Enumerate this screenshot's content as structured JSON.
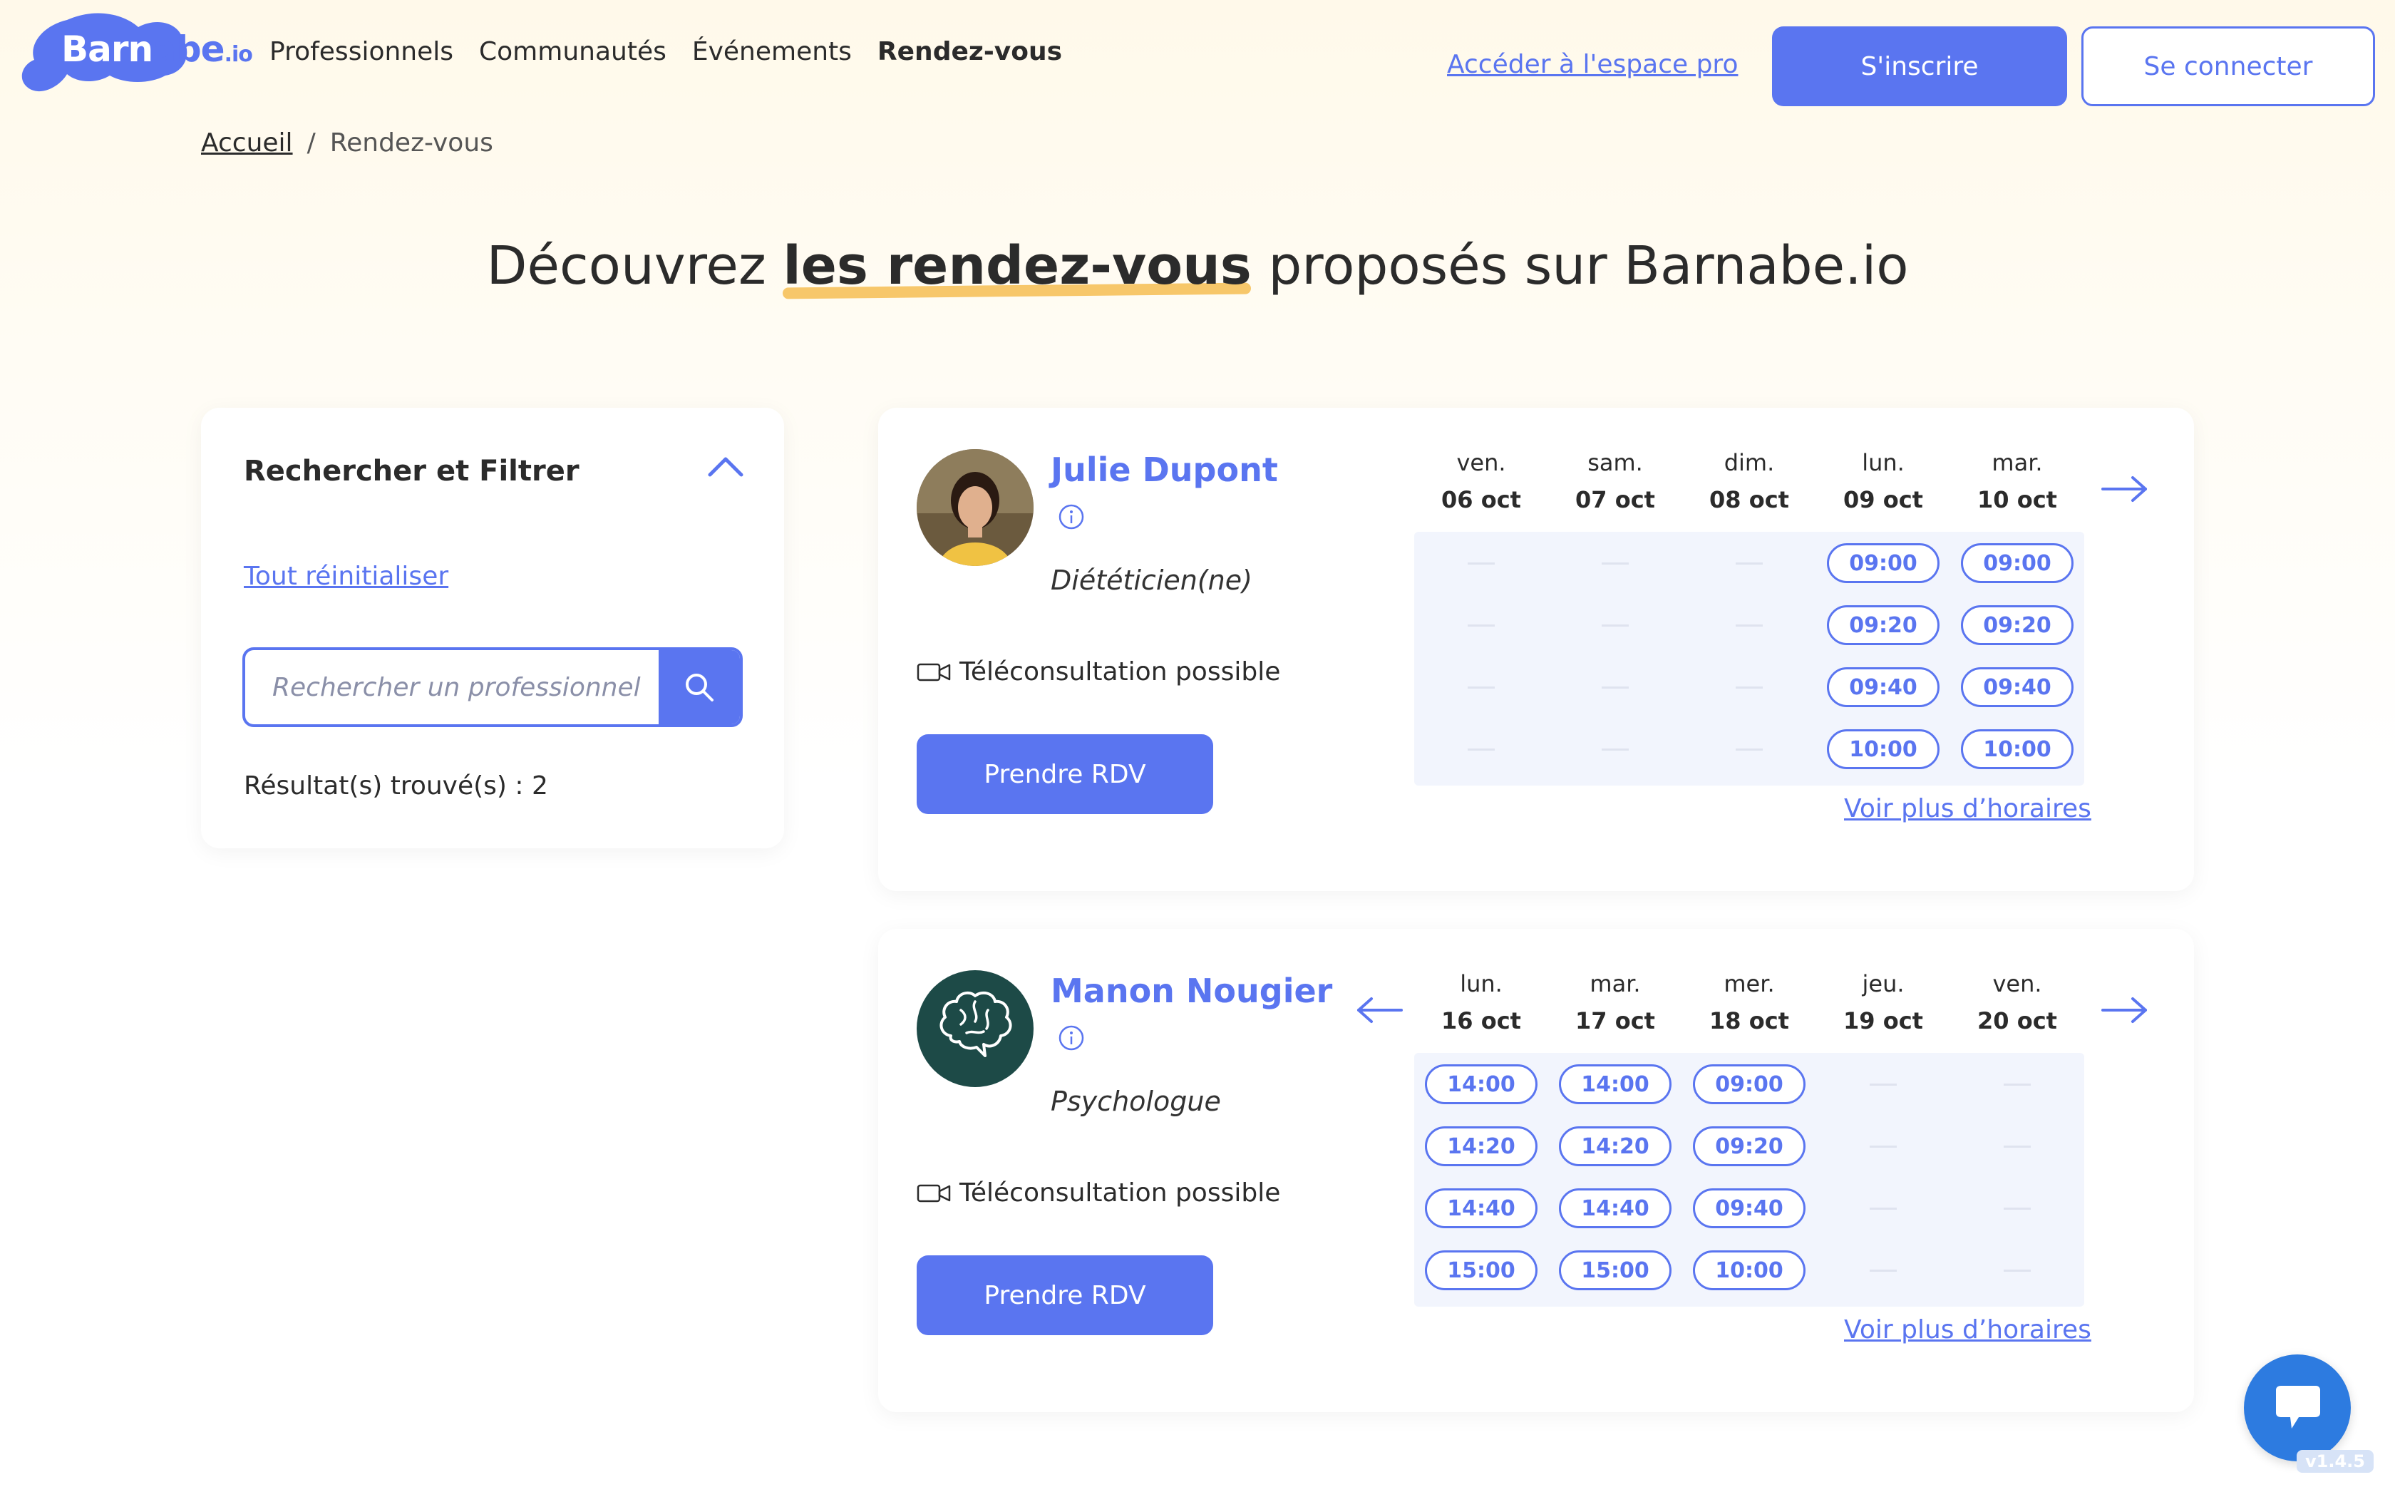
{
  "header": {
    "logo": {
      "part1": "Barn",
      "part2": "abe",
      "suffix": ".io"
    },
    "nav": [
      "Professionnels",
      "Communautés",
      "Événements",
      "Rendez-vous"
    ],
    "pro_link": "Accéder à l'espace pro",
    "signup": "S'inscrire",
    "login": "Se connecter"
  },
  "breadcrumb": {
    "home": "Accueil",
    "sep": "/",
    "current": "Rendez-vous"
  },
  "headline": {
    "before": "Découvrez ",
    "highlight": "les rendez-vous",
    "after": " proposés sur Barnabe.io"
  },
  "filter": {
    "title": "Rechercher et Filtrer",
    "reset": "Tout réinitialiser",
    "search_placeholder": "Rechercher un professionnel",
    "results": "Résultat(s) trouvé(s) : 2"
  },
  "colors": {
    "accent": "#5a75f0",
    "highlight": "#f7c76a",
    "grid_bg": "#f2f5fd",
    "avatar_dark": "#1d4a47",
    "chat": "#2d7be0"
  },
  "professionals": [
    {
      "name": "Julie Dupont",
      "specialty": "Diététicien(ne)",
      "avatar_icon": "person-photo",
      "teleconsult": "Téléconsultation possible",
      "cta": "Prendre RDV",
      "more": "Voir plus d’horaires",
      "prev_arrow": false,
      "days": [
        {
          "name": "ven.",
          "date": "06 oct",
          "slots": [
            "—",
            "—",
            "—",
            "—"
          ]
        },
        {
          "name": "sam.",
          "date": "07 oct",
          "slots": [
            "—",
            "—",
            "—",
            "—"
          ]
        },
        {
          "name": "dim.",
          "date": "08 oct",
          "slots": [
            "—",
            "—",
            "—",
            "—"
          ]
        },
        {
          "name": "lun.",
          "date": "09 oct",
          "slots": [
            "09:00",
            "09:20",
            "09:40",
            "10:00"
          ]
        },
        {
          "name": "mar.",
          "date": "10 oct",
          "slots": [
            "09:00",
            "09:20",
            "09:40",
            "10:00"
          ]
        }
      ]
    },
    {
      "name": "Manon Nougier",
      "specialty": "Psychologue",
      "avatar_icon": "brain-icon",
      "teleconsult": "Téléconsultation possible",
      "cta": "Prendre RDV",
      "more": "Voir plus d’horaires",
      "prev_arrow": true,
      "days": [
        {
          "name": "lun.",
          "date": "16 oct",
          "slots": [
            "14:00",
            "14:20",
            "14:40",
            "15:00"
          ]
        },
        {
          "name": "mar.",
          "date": "17 oct",
          "slots": [
            "14:00",
            "14:20",
            "14:40",
            "15:00"
          ]
        },
        {
          "name": "mer.",
          "date": "18 oct",
          "slots": [
            "09:00",
            "09:20",
            "09:40",
            "10:00"
          ]
        },
        {
          "name": "jeu.",
          "date": "19 oct",
          "slots": [
            "—",
            "—",
            "—",
            "—"
          ]
        },
        {
          "name": "ven.",
          "date": "20 oct",
          "slots": [
            "—",
            "—",
            "—",
            "—"
          ]
        }
      ]
    }
  ],
  "version": "v1.4.5"
}
